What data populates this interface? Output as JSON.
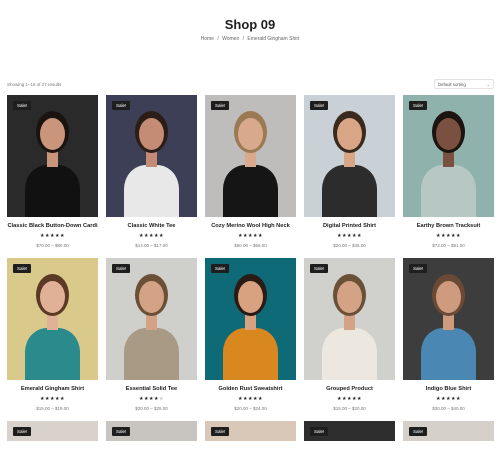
{
  "page": {
    "title": "Shop 09",
    "breadcrumb": [
      "Home",
      "/",
      "Women",
      "/",
      "Emerald Gingham Shirt"
    ]
  },
  "toolbar": {
    "result_count": "Showing 1–15 of 27 results",
    "sort_value": "Default sorting"
  },
  "colors": {
    "text": "#1e1e1e",
    "badge_bg": "#1e1e1e",
    "star": "#222222"
  },
  "products": [
    {
      "name": "Classic Black Button-Down Cardi",
      "price": "$70.00 – $80.00",
      "rating": 5,
      "sale": "Sale!",
      "bg": "#2a2a2a",
      "skin": "#c9957b",
      "top": "#111111",
      "hair": "#1a1410"
    },
    {
      "name": "Classic White Tee",
      "price": "$14.00 – $17.00",
      "rating": 5,
      "sale": "Sale!",
      "bg": "#3d3f57",
      "skin": "#c48c74",
      "top": "#e8e8e8",
      "hair": "#2b1e16"
    },
    {
      "name": "Cozy Merino Wool High Neck",
      "price": "$60.00 – $65.00",
      "rating": 5,
      "sale": "Sale!",
      "bg": "#bfbdbc",
      "skin": "#d9a98b",
      "top": "#151515",
      "hair": "#9a7a55"
    },
    {
      "name": "Digital Printed Shirt",
      "price": "$20.00 – $35.00",
      "rating": 5,
      "sale": "Sale!",
      "bg": "#c9d0d6",
      "skin": "#d8a586",
      "top": "#2c2c2c",
      "hair": "#3a2a1e"
    },
    {
      "name": "Earthy Brown Tracksuit",
      "price": "$73.00 – $81.00",
      "rating": 5,
      "sale": "Sale!",
      "bg": "#8fb3ac",
      "skin": "#7a5040",
      "top": "#b7c8c4",
      "hair": "#1b1410"
    },
    {
      "name": "Emerald Gingham Shirt",
      "price": "$15.00 – $19.00",
      "rating": 5,
      "sale": "Sale!",
      "bg": "#d9c98a",
      "skin": "#e0b197",
      "top": "#2b8a8c",
      "hair": "#5a3a24"
    },
    {
      "name": "Essential Solid Tee",
      "price": "$20.00 – $25.00",
      "rating": 4,
      "sale": "Sale!",
      "bg": "#cfcfcb",
      "skin": "#d4a386",
      "top": "#a89a84",
      "hair": "#6b5038"
    },
    {
      "name": "Golden Rust Sweatshirt",
      "price": "$20.00 – $24.00",
      "rating": 5,
      "sale": "Sale!",
      "bg": "#0f6a78",
      "skin": "#d8a280",
      "top": "#d9871f",
      "hair": "#2a1c14"
    },
    {
      "name": "Grouped Product",
      "price": "$15.00 – $20.00",
      "rating": 5,
      "sale": "Sale!",
      "bg": "#d0d0cc",
      "skin": "#d4a386",
      "top": "#ece8df",
      "hair": "#6b5038"
    },
    {
      "name": "Indigo Blue Shirt",
      "price": "$30.00 – $40.00",
      "rating": 5,
      "sale": "Sale!",
      "bg": "#3d3d3d",
      "skin": "#cf9b7f",
      "top": "#4a88b3",
      "hair": "#6a4a34"
    },
    {
      "name": "",
      "price": "",
      "rating": 0,
      "sale": "Sale!",
      "bg": "#d8d2cb",
      "skin": "#d4a386",
      "top": "#d8d2cb",
      "hair": "#d8d2cb"
    },
    {
      "name": "",
      "price": "",
      "rating": 0,
      "sale": "Sale!",
      "bg": "#c8c4bf",
      "skin": "#c8c4bf",
      "top": "#c8c4bf",
      "hair": "#3a2a20"
    },
    {
      "name": "",
      "price": "",
      "rating": 0,
      "sale": "Sale!",
      "bg": "#d9c8b8",
      "skin": "#d9c8b8",
      "top": "#d9c8b8",
      "hair": "#d9c8b8"
    },
    {
      "name": "",
      "price": "",
      "rating": 0,
      "sale": "Sale!",
      "bg": "#2e2e2e",
      "skin": "#2e2e2e",
      "top": "#2e2e2e",
      "hair": "#2e2e2e"
    },
    {
      "name": "",
      "price": "",
      "rating": 0,
      "sale": "Sale!",
      "bg": "#d5d0c9",
      "skin": "#d5d0c9",
      "top": "#d5d0c9",
      "hair": "#d5d0c9"
    }
  ]
}
